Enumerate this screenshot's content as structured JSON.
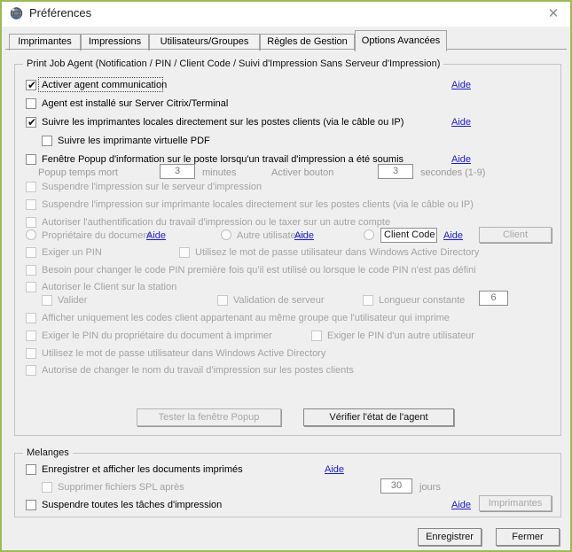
{
  "window": {
    "title": "Préférences",
    "icon": "app-globe-icon",
    "close_label": "✕",
    "border_color": "#9bbb54"
  },
  "tabs": [
    {
      "label": "Imprimantes",
      "active": false
    },
    {
      "label": "Impressions",
      "active": false
    },
    {
      "label": "Utilisateurs/Groupes",
      "active": false
    },
    {
      "label": "Règles de Gestion",
      "active": false
    },
    {
      "label": "Options Avancées",
      "active": true
    }
  ],
  "agent_group": {
    "title": "Print Job Agent (Notification / PIN / Client Code / Suivi d'Impression Sans Serveur d'Impression)",
    "rows": {
      "activer_agent": "Activer agent communication",
      "agent_citrix": "Agent est installé sur Server Citrix/Terminal",
      "suivre_locales": "Suivre les imprimantes locales directement sur les postes clients (via le câble ou IP)",
      "suivre_pdf": "Suivre les imprimante virtuelle PDF",
      "popup_info": "Fenêtre Popup d'information sur le poste lorsqu'un travail d'impression a été soumis",
      "popup_temps_mort": "Popup temps mort",
      "popup_temps_mort_value": "3",
      "minutes": "minutes",
      "activer_bouton": "Activer bouton",
      "activer_bouton_value": "3",
      "secondes": "secondes (1-9)",
      "suspendre_serveur": "Suspendre l'impression sur le serveur d'impression",
      "suspendre_locales": "Suspendre l'impression sur imprimante locales directement sur les postes clients (via le câble ou IP)",
      "autoriser_auth": "Autoriser l'authentification du travail d'impression ou le taxer sur un autre compte",
      "proprietaire": "Propriétaire du document",
      "autre_utilisateur": "Autre utilisateur",
      "client_code_value": "Client Code",
      "client_button": "Client",
      "exiger_pin": "Exiger un PIN",
      "utilisez_mdp_ad": "Utilisez le mot de passe utilisateur dans Windows Active Directory",
      "besoin_changer_pin": "Besoin pour changer le code PIN première fois qu'il est utilisé ou lorsque le code PIN n'est pas défini",
      "autoriser_client_station": "Autoriser le Client sur la station",
      "valider": "Valider",
      "validation_serveur": "Validation de serveur",
      "longueur_constante": "Longueur constante",
      "longueur_value": "6",
      "afficher_codes_client": "Afficher uniquement les codes client appartenant au même groupe que l'utilisateur qui imprime",
      "exiger_pin_proprietaire": "Exiger le PIN du propriétaire du document à imprimer",
      "exiger_pin_autre": "Exiger le  PIN  d'un autre utilisateur",
      "utilisez_mdp_ad2": "Utilisez le mot de passe utilisateur dans Windows Active Directory",
      "autorise_changer_nom": "Autorise de  changer le nom du travail d'impression sur les postes clients"
    },
    "buttons": {
      "tester_popup": "Tester la fenêtre Popup",
      "verifier_agent": "Vérifier l'état de l'agent"
    },
    "aide": "Aide"
  },
  "melanges_group": {
    "title": "Melanges",
    "rows": {
      "enregistrer_afficher": "Enregistrer et afficher les documents imprimés",
      "supprimer_spl": "Supprimer fichiers SPL après",
      "supprimer_spl_value": "30",
      "jours": "jours",
      "suspendre_toutes": "Suspendre toutes les tâches d'impression"
    },
    "aide": "Aide",
    "imprimantes_button": "Imprimantes"
  },
  "footer": {
    "save": "Enregistrer",
    "close": "Fermer"
  },
  "check_glyph": "✔"
}
